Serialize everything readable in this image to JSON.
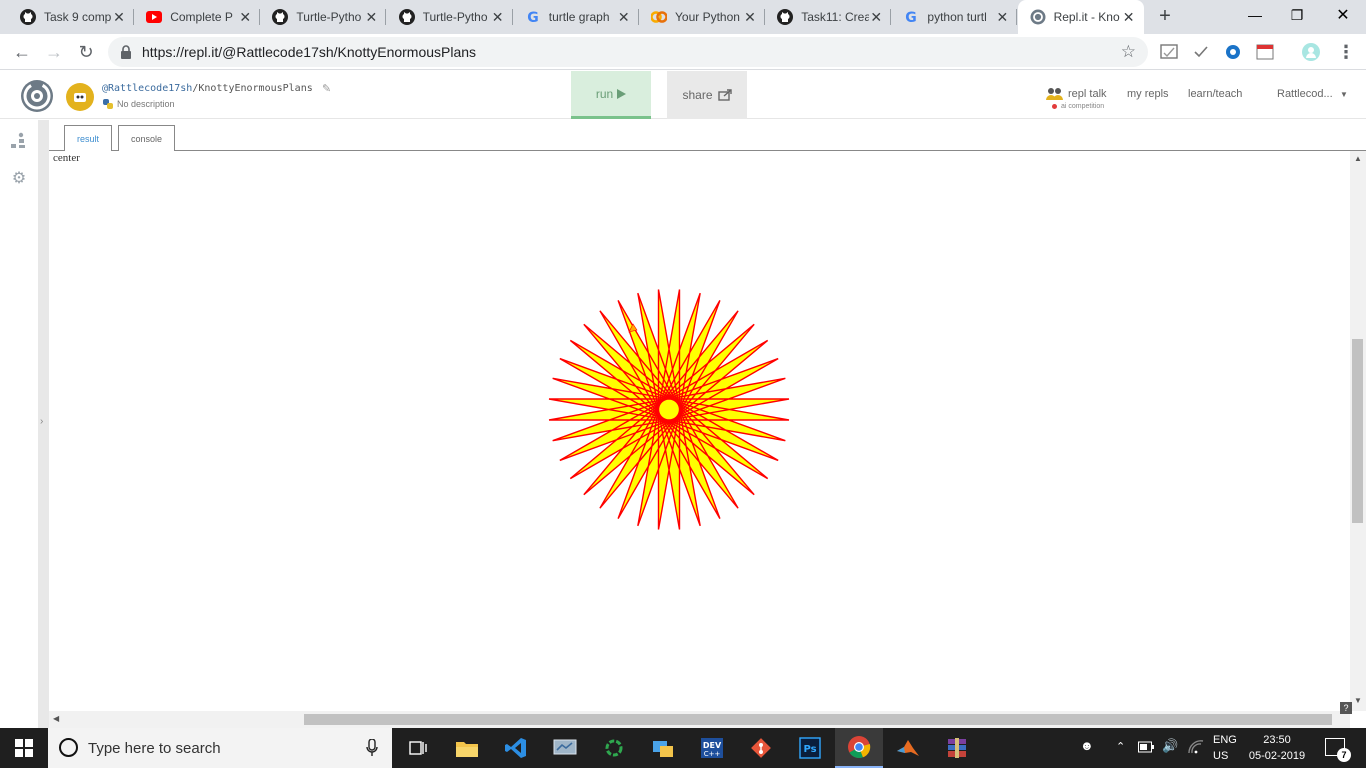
{
  "browser": {
    "tabs": [
      {
        "title": "Task 9 comp",
        "icon": "github-icon"
      },
      {
        "title": "Complete P",
        "icon": "youtube-icon"
      },
      {
        "title": "Turtle-Pytho",
        "icon": "github-icon"
      },
      {
        "title": "Turtle-Pytho",
        "icon": "github-icon"
      },
      {
        "title": "turtle graph",
        "icon": "google-icon"
      },
      {
        "title": "Your Python",
        "icon": "colab-icon"
      },
      {
        "title": "Task11: Crea",
        "icon": "github-icon"
      },
      {
        "title": "python turtl",
        "icon": "google-icon"
      },
      {
        "title": "Repl.it - Kno",
        "icon": "replit-icon"
      }
    ],
    "url": "https://repl.it/@Rattlecode17sh/KnottyEnormousPlans"
  },
  "repl": {
    "user": "@Rattlecode17sh",
    "project": "KnottyEnormousPlans",
    "description": "No description",
    "run_label": "run",
    "share_label": "share",
    "nav": {
      "talk": "repl talk",
      "talk_sub": "ai competition",
      "my_repls": "my repls",
      "learn": "learn/teach",
      "account": "Rattlecod..."
    },
    "tabs": {
      "result": "result",
      "console": "console"
    }
  },
  "output": {
    "label": "center",
    "drawing": {
      "points": 36,
      "fill": "#ffff00",
      "stroke": "#ff0000"
    }
  },
  "taskbar": {
    "search_placeholder": "Type here to search",
    "lang_line1": "ENG",
    "lang_line2": "US",
    "time": "23:50",
    "date": "05-02-2019",
    "notifications": "7"
  },
  "colors": {
    "run_bg": "#d9eedd",
    "accent": "#3e8ed0",
    "taskbar": "#1f1f1f"
  }
}
